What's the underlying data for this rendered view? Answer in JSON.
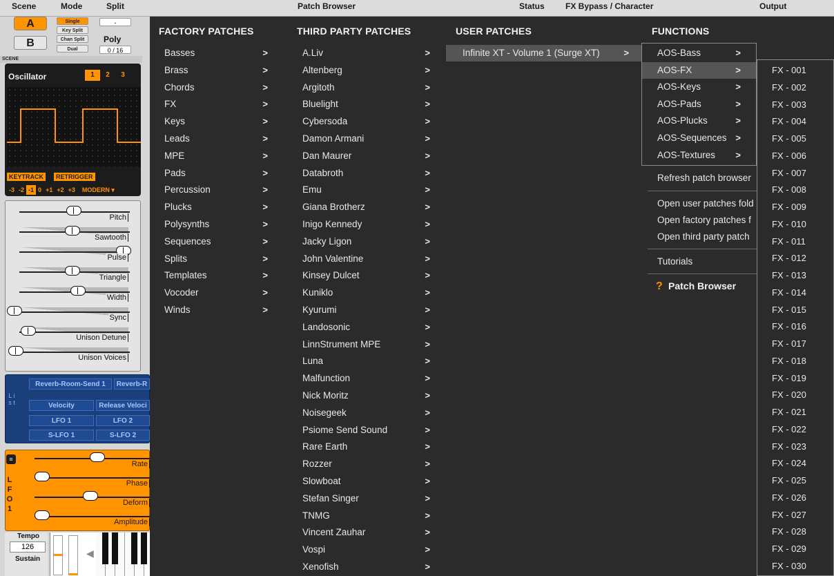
{
  "header": {
    "scene": "Scene",
    "mode": "Mode",
    "split": "Split",
    "patch_browser": "Patch Browser",
    "status": "Status",
    "fx_bypass": "FX Bypass / Character",
    "output": "Output"
  },
  "left": {
    "scene_a": "A",
    "scene_b": "B",
    "scene_label": "SCENE",
    "modes": [
      "Single",
      "Key Split",
      "Chan Split",
      "Dual"
    ],
    "split_value": "-",
    "poly": "Poly",
    "poly_value": "0 / 16",
    "osc_title": "Oscillator",
    "osc_numbers": [
      "1",
      "2",
      "3"
    ],
    "keytrack": "KEYTRACK",
    "retrigger": "RETRIGGER",
    "octaves": [
      "-3",
      "-2",
      "-1",
      "0",
      "+1",
      "+2",
      "+3"
    ],
    "osc_mode": "MODERN ▾",
    "sliders": [
      "Pitch",
      "Sawtooth",
      "Pulse",
      "Triangle",
      "Width",
      "Sync",
      "Unison Detune",
      "Unison Voices"
    ],
    "mod_side": "L i s t",
    "mod_buttons": [
      "Reverb-Room-Send 1",
      "Reverb-R",
      "Velocity",
      "Release Veloci",
      "LFO 1",
      "LFO 2",
      "S-LFO 1",
      "S-LFO 2"
    ],
    "lfo_side": "L F O  1",
    "lfo_sliders": [
      "Rate",
      "Phase",
      "Deform",
      "Amplitude"
    ],
    "tempo_label": "Tempo",
    "tempo_value": "126",
    "sustain_label": "Sustain"
  },
  "menu": {
    "factory_header": "FACTORY PATCHES",
    "factory": [
      "Basses",
      "Brass",
      "Chords",
      "FX",
      "Keys",
      "Leads",
      "MPE",
      "Pads",
      "Percussion",
      "Plucks",
      "Polysynths",
      "Sequences",
      "Splits",
      "Templates",
      "Vocoder",
      "Winds"
    ],
    "third_header": "THIRD PARTY PATCHES",
    "third": [
      "A.Liv",
      "Altenberg",
      "Argitoth",
      "Bluelight",
      "Cybersoda",
      "Damon Armani",
      "Dan Maurer",
      "Databroth",
      "Emu",
      "Giana Brotherz",
      "Inigo Kennedy",
      "Jacky Ligon",
      "John Valentine",
      "Kinsey Dulcet",
      "Kuniklo",
      "Kyurumi",
      "Landosonic",
      "LinnStrument MPE",
      "Luna",
      "Malfunction",
      "Nick Moritz",
      "Noisegeek",
      "Psiome Send Sound",
      "Rare Earth",
      "Rozzer",
      "Slowboat",
      "Stefan Singer",
      "TNMG",
      "Vincent Zauhar",
      "Vospi",
      "Xenofish"
    ],
    "user_header": "USER PATCHES",
    "user": [
      "Infinite XT - Volume 1 (Surge XT)"
    ],
    "functions_header": "FUNCTIONS",
    "aos": [
      "AOS-Bass",
      "AOS-FX",
      "AOS-Keys",
      "AOS-Pads",
      "AOS-Plucks",
      "AOS-Sequences",
      "AOS-Textures"
    ],
    "functions": [
      "Refresh patch browser",
      "Open user patches fold",
      "Open factory patches f",
      "Open third party patch",
      "Tutorials"
    ],
    "help": "Patch Browser",
    "fx": [
      "FX - 001",
      "FX - 002",
      "FX - 003",
      "FX - 004",
      "FX - 005",
      "FX - 006",
      "FX - 007",
      "FX - 008",
      "FX - 009",
      "FX - 010",
      "FX - 011",
      "FX - 012",
      "FX - 013",
      "FX - 014",
      "FX - 015",
      "FX - 016",
      "FX - 017",
      "FX - 018",
      "FX - 019",
      "FX - 020",
      "FX - 021",
      "FX - 022",
      "FX - 023",
      "FX - 024",
      "FX - 025",
      "FX - 026",
      "FX - 027",
      "FX - 028",
      "FX - 029",
      "FX - 030"
    ]
  },
  "colors": {
    "accent": "#ff9300",
    "menu_bg": "#2b2b2b",
    "mod_blue": "#1a3f7a"
  }
}
